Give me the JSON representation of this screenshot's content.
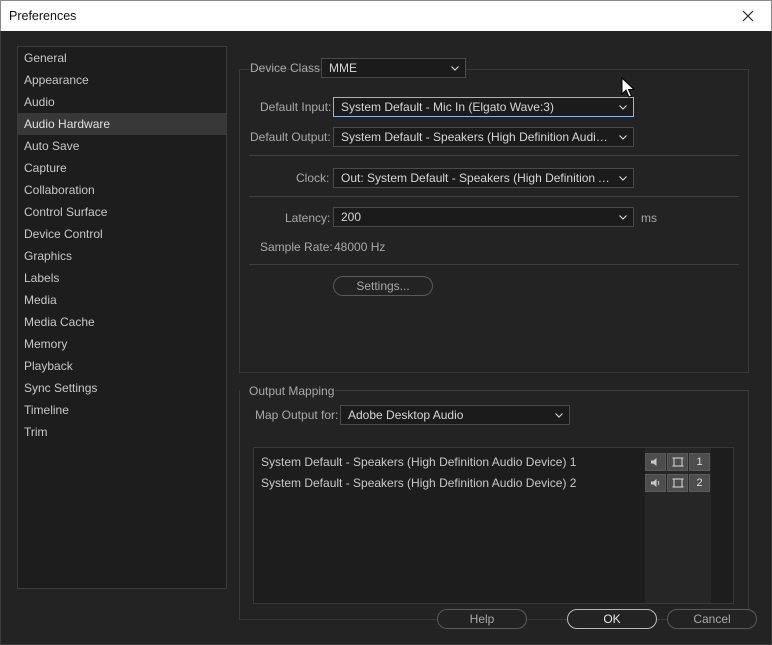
{
  "window": {
    "title": "Preferences"
  },
  "sidebar": {
    "items": [
      {
        "label": "General"
      },
      {
        "label": "Appearance"
      },
      {
        "label": "Audio"
      },
      {
        "label": "Audio Hardware",
        "selected": true
      },
      {
        "label": "Auto Save"
      },
      {
        "label": "Capture"
      },
      {
        "label": "Collaboration"
      },
      {
        "label": "Control Surface"
      },
      {
        "label": "Device Control"
      },
      {
        "label": "Graphics"
      },
      {
        "label": "Labels"
      },
      {
        "label": "Media"
      },
      {
        "label": "Media Cache"
      },
      {
        "label": "Memory"
      },
      {
        "label": "Playback"
      },
      {
        "label": "Sync Settings"
      },
      {
        "label": "Timeline"
      },
      {
        "label": "Trim"
      }
    ]
  },
  "device": {
    "class_label": "Device Class:",
    "class_value": "MME",
    "input_label": "Default Input:",
    "input_value": "System Default - Mic In (Elgato Wave:3)",
    "output_label": "Default Output:",
    "output_value": "System Default - Speakers (High Definition Audio Dev...",
    "clock_label": "Clock:",
    "clock_value": "Out: System Default - Speakers (High Definition Audi...",
    "latency_label": "Latency:",
    "latency_value": "200",
    "latency_unit": "ms",
    "sample_rate_label": "Sample Rate:",
    "sample_rate_value": "48000 Hz",
    "settings_button": "Settings..."
  },
  "output_mapping": {
    "section_label": "Output Mapping",
    "map_label": "Map Output for:",
    "map_value": "Adobe Desktop Audio",
    "rows": [
      {
        "label": "System Default - Speakers (High Definition Audio Device) 1",
        "channel": "1"
      },
      {
        "label": "System Default - Speakers (High Definition Audio Device) 2",
        "channel": "2"
      }
    ]
  },
  "buttons": {
    "help": "Help",
    "ok": "OK",
    "cancel": "Cancel"
  }
}
